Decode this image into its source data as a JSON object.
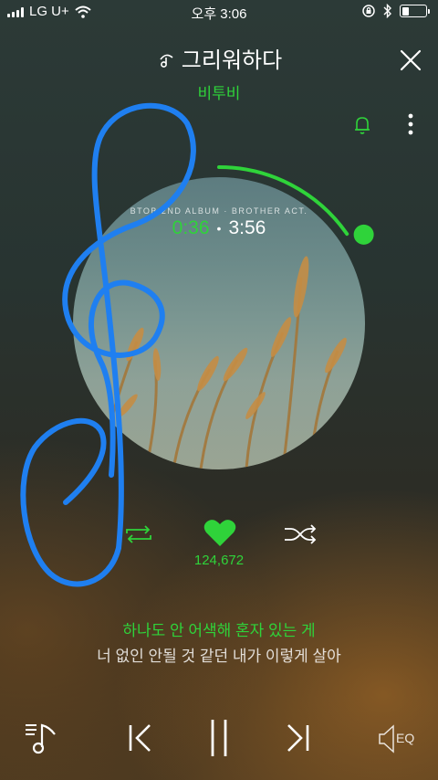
{
  "status_bar": {
    "carrier": "LG U+",
    "time": "오후 3:06",
    "battery_level": 0.25
  },
  "header": {
    "title": "그리워하다",
    "artist": "비투비",
    "close_icon": "close-icon",
    "bell_icon": "bell-icon",
    "more_icon": "more-vertical-icon"
  },
  "album": {
    "cover_text": "BTOB 2ND ALBUM · BROTHER ACT.",
    "elapsed": "0:36",
    "duration": "3:56",
    "progress": 0.153
  },
  "actions": {
    "repeat_icon": "repeat-icon",
    "like_icon": "heart-icon",
    "like_count": "124,672",
    "shuffle_icon": "shuffle-icon"
  },
  "lyrics": {
    "current": "하나도 안 어색해 혼자 있는 게",
    "next": "너 없인 안될 것 같던 내가 이렇게 살아"
  },
  "player": {
    "playlist_icon": "playlist-icon",
    "prev_icon": "previous-icon",
    "pause_icon": "pause-icon",
    "next_icon": "next-icon",
    "eq_label": "EQ"
  },
  "colors": {
    "accent": "#2fd33a",
    "annotation": "#1f7ff0"
  }
}
